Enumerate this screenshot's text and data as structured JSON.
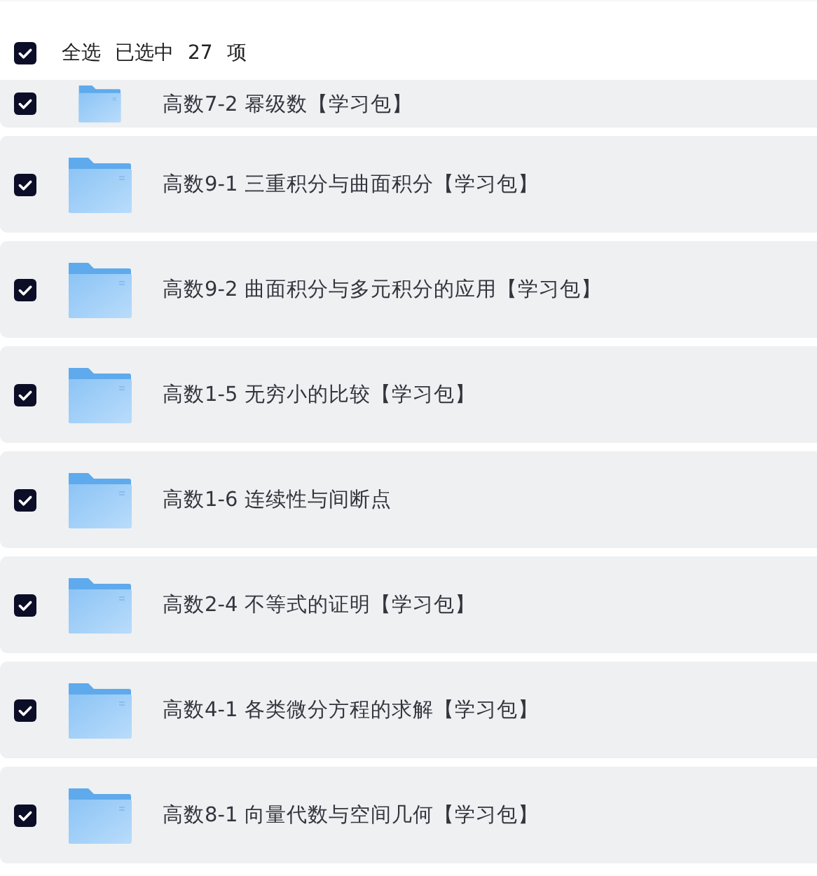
{
  "header": {
    "select_all_checked": true,
    "select_all_label": "全选",
    "selected_label": "已选中",
    "count": "27",
    "unit": "项"
  },
  "items": [
    {
      "name": "高数7-2 幂级数【学习包】",
      "checked": true
    },
    {
      "name": "高数9-1 三重积分与曲面积分【学习包】",
      "checked": true
    },
    {
      "name": "高数9-2 曲面积分与多元积分的应用【学习包】",
      "checked": true
    },
    {
      "name": "高数1-5 无穷小的比较【学习包】",
      "checked": true
    },
    {
      "name": "高数1-6 连续性与间断点",
      "checked": true
    },
    {
      "name": "高数2-4 不等式的证明【学习包】",
      "checked": true
    },
    {
      "name": "高数4-1 各类微分方程的求解【学习包】",
      "checked": true
    },
    {
      "name": "高数8-1 向量代数与空间几何【学习包】",
      "checked": true
    }
  ]
}
